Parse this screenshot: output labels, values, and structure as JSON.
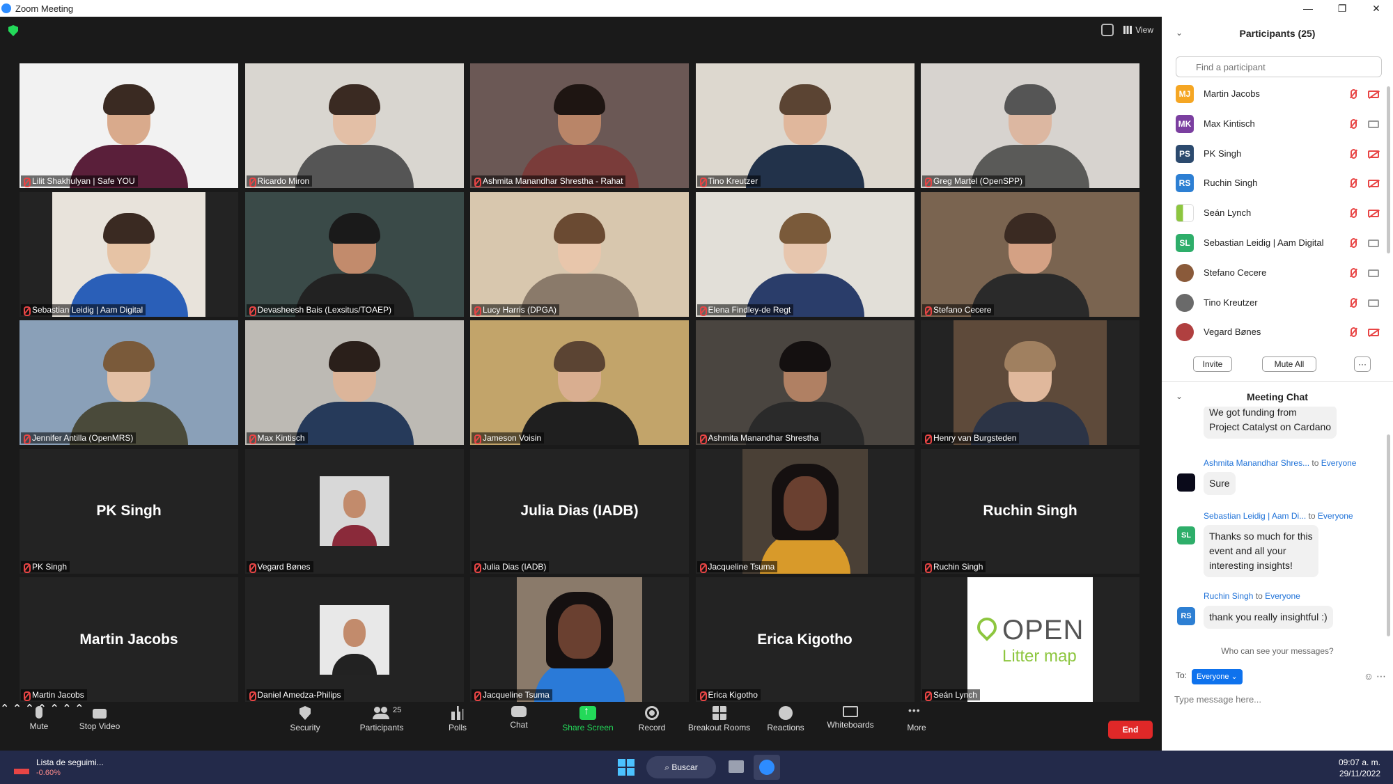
{
  "window": {
    "title": "Zoom Meeting",
    "controls": [
      "—",
      "❐",
      "✕"
    ]
  },
  "meeting": {
    "view_label": "View"
  },
  "tiles": [
    {
      "label": "Lilit Shakhulyan | Safe YOU",
      "kind": "video",
      "bg": "#f2f2f2",
      "shirt": "#5a1f3a",
      "hair": "#3a2a22",
      "skin": "#d9aa8c"
    },
    {
      "label": "Ricardo Miron",
      "kind": "video",
      "bg": "#d9d6d0",
      "shirt": "#555",
      "hair": "#3a2a22",
      "skin": "#e3bfa6",
      "active": true
    },
    {
      "label": "Ashmita Manandhar Shrestha - Rahat",
      "kind": "video",
      "bg": "#6b5855",
      "shirt": "#7a3c3a",
      "hair": "#1e1512",
      "skin": "#b98568"
    },
    {
      "label": "Tino Kreutzer",
      "kind": "video",
      "bg": "#ddd8cf",
      "shirt": "#22324a",
      "hair": "#5b4433",
      "skin": "#e0b79c"
    },
    {
      "label": "Greg Martel (OpenSPP)",
      "kind": "video",
      "bg": "#d7d3cf",
      "shirt": "#5a5a58",
      "hair": "#555",
      "skin": "#dcb7a1"
    },
    {
      "label": "Sebastian Leidig | Aam Digital",
      "kind": "video",
      "bg": "#e8e3db",
      "shirt": "#2a5fb8",
      "hair": "#3a2a22",
      "skin": "#e6c3a5",
      "narrow": true
    },
    {
      "label": "Devasheesh Bais (Lexsitus/TOAEP)",
      "kind": "video",
      "bg": "#3a4a48",
      "shirt": "#222",
      "hair": "#1a1a1a",
      "skin": "#c28b6c"
    },
    {
      "label": "Lucy Harris (DPGA)",
      "kind": "video",
      "bg": "#d8c7ae",
      "shirt": "#8a7a6a",
      "hair": "#6a4a32",
      "skin": "#e8c6ab"
    },
    {
      "label": "Elena Findley-de Regt",
      "kind": "video",
      "bg": "#e2dfd8",
      "shirt": "#2a3d6a",
      "hair": "#7a5a3a",
      "skin": "#e7c6ae"
    },
    {
      "label": "Stefano Cecere",
      "kind": "video",
      "bg": "#7a6450",
      "shirt": "#2a2a2a",
      "hair": "#3a2a22",
      "skin": "#d4a184"
    },
    {
      "label": "Jennifer Antilla (OpenMRS)",
      "kind": "video",
      "bg": "#8aa0b8",
      "shirt": "#4a4a3a",
      "hair": "#7a5a3a",
      "skin": "#e3c0a5"
    },
    {
      "label": "Max Kintisch",
      "kind": "video",
      "bg": "#bdbab4",
      "shirt": "#263a5a",
      "hair": "#2a1f1a",
      "skin": "#dcb59a"
    },
    {
      "label": "Jameson Voisin",
      "kind": "video",
      "bg": "#c2a46a",
      "shirt": "#1f1f1f",
      "hair": "#5b4433",
      "skin": "#d9ae90"
    },
    {
      "label": "Ashmita Manandhar Shrestha",
      "kind": "video",
      "bg": "#4a4540",
      "shirt": "#2a2a2a",
      "hair": "#141010",
      "skin": "#b08063"
    },
    {
      "label": "Henry van Burgsteden",
      "kind": "video",
      "bg": "#5e4a3a",
      "shirt": "#2c3446",
      "hair": "#a08060",
      "skin": "#e0b89c",
      "narrow": true
    },
    {
      "label": "PK Singh",
      "kind": "name",
      "name": "PK Singh"
    },
    {
      "label": "Vegard Bønes",
      "kind": "photo",
      "ph_bg": "#d8d8d8",
      "ph_shirt": "#8a2a3a"
    },
    {
      "label": "Julia Dias (IADB)",
      "kind": "name",
      "name": "Julia Dias (IADB)"
    },
    {
      "label": "Jacqueline Tsuma",
      "kind": "portrait",
      "bg": "#4a4036",
      "shirt": "#d89a2a",
      "hair": "#151010",
      "skin": "#6a4030"
    },
    {
      "label": "Ruchin Singh",
      "kind": "name",
      "name": "Ruchin Singh"
    },
    {
      "label": "Martin Jacobs",
      "kind": "name",
      "name": "Martin Jacobs"
    },
    {
      "label": "Daniel Amedza-Philips",
      "kind": "photo",
      "ph_bg": "#e8e8e8",
      "ph_shirt": "#222"
    },
    {
      "label": "Jacqueline Tsuma",
      "kind": "portrait",
      "bg": "#8a7a6a",
      "shirt": "#2a7ad8",
      "hair": "#151010",
      "skin": "#6a4030"
    },
    {
      "label": "Erica Kigotho",
      "kind": "name",
      "name": "Erica Kigotho"
    },
    {
      "label": "Seán Lynch",
      "kind": "logo",
      "logo_line1": "OPEN",
      "logo_line2": "Litter map"
    }
  ],
  "toolbar": {
    "mute": "Mute",
    "stop_video": "Stop Video",
    "security": "Security",
    "participants": "Participants",
    "participants_count": "25",
    "polls": "Polls",
    "chat": "Chat",
    "share_screen": "Share Screen",
    "record": "Record",
    "breakout_rooms": "Breakout Rooms",
    "reactions": "Reactions",
    "whiteboards": "Whiteboards",
    "more": "More",
    "end": "End"
  },
  "participants_panel": {
    "title": "Participants (25)",
    "search_placeholder": "Find a participant",
    "items": [
      {
        "name": "Martin Jacobs",
        "initials": "MJ",
        "color": "#f5a623",
        "cam_off": true
      },
      {
        "name": "Max Kintisch",
        "initials": "MK",
        "color": "#7b3fa0",
        "cam_off": false
      },
      {
        "name": "PK Singh",
        "initials": "PS",
        "color": "#2c4a6e",
        "cam_off": true
      },
      {
        "name": "Ruchin Singh",
        "initials": "RS",
        "color": "#2d7fd3",
        "cam_off": true
      },
      {
        "name": "Seán Lynch",
        "initials": "",
        "color": "#ffffff",
        "cam_off": true,
        "logo": true
      },
      {
        "name": "Sebastian Leidig | Aam Digital",
        "initials": "SL",
        "color": "#2eae6a",
        "cam_off": false
      },
      {
        "name": "Stefano Cecere",
        "initials": "",
        "color": "#8a5a3a",
        "cam_off": false,
        "img": true
      },
      {
        "name": "Tino Kreutzer",
        "initials": "",
        "color": "#6a6a6a",
        "cam_off": false,
        "img": true
      },
      {
        "name": "Vegard Bønes",
        "initials": "",
        "color": "#b04040",
        "cam_off": true,
        "img": true
      }
    ],
    "invite": "Invite",
    "mute_all": "Mute All",
    "more": "···"
  },
  "chat": {
    "title": "Meeting Chat",
    "messages": [
      {
        "text_1": "We got funding from",
        "text_2": "Project Catalyst on Cardano"
      },
      {
        "sender": "Ashmita Manandhar Shres...",
        "to": "to",
        "recipient": "Everyone",
        "text": "Sure"
      },
      {
        "sender": "Sebastian Leidig | Aam Di...",
        "to": "to",
        "recipient": "Everyone",
        "initials": "SL",
        "text_1": "Thanks so much for this",
        "text_2": "event and all your",
        "text_3": "interesting insights!"
      },
      {
        "sender": "Ruchin Singh",
        "to": "to",
        "recipient": "Everyone",
        "initials": "RS",
        "text": "thank you really insightful :)"
      }
    ],
    "who_can_see": "Who can see your messages?",
    "to_label": "To:",
    "to_value": "Everyone",
    "input_placeholder": "Type message here..."
  },
  "taskbar": {
    "stock_name": "Lista de seguimi...",
    "stock_change": "-0.60%",
    "search": "Buscar",
    "time": "09:07 a. m.",
    "date": "29/11/2022"
  }
}
